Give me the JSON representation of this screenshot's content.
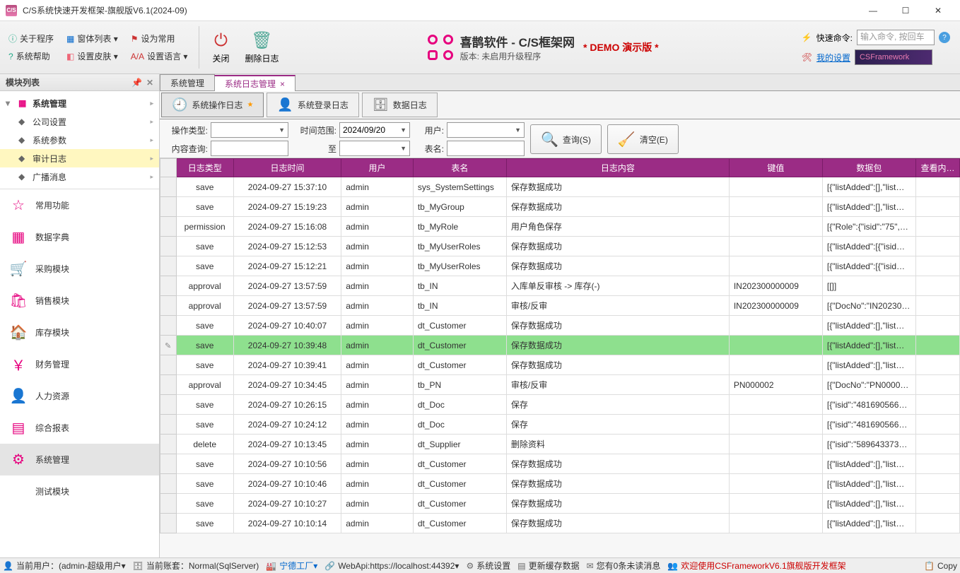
{
  "window": {
    "title": "C/S系统快速开发框架-旗舰版V6.1(2024-09)"
  },
  "ribbon": {
    "about": "关于程序",
    "winlist": "窗体列表 ▾",
    "setcommon": "设为常用",
    "syshelp": "系统帮助",
    "setskin": "设置皮肤 ▾",
    "setlang": "设置语言 ▾",
    "close": "关闭",
    "dellog": "删除日志",
    "brand1": "喜鹊软件 - C/S框架网",
    "brand2": "版本: 未启用升级程序",
    "demo": "* DEMO 演示版 *",
    "quickcmd": "快速命令:",
    "cmdplaceholder": "输入命令, 按回车",
    "mysettings": "我的设置",
    "cfbanner": "CSFramework"
  },
  "sidebar": {
    "header": "模块列表",
    "tree": {
      "root": "系统管理",
      "items": [
        "公司设置",
        "系统参数",
        "审计日志",
        "广播消息"
      ]
    },
    "mods": [
      {
        "icon": "☆",
        "label": "常用功能"
      },
      {
        "icon": "▦",
        "label": "数据字典"
      },
      {
        "icon": "🛒",
        "label": "采购模块"
      },
      {
        "icon": "🛍",
        "label": "销售模块"
      },
      {
        "icon": "🏠",
        "label": "库存模块"
      },
      {
        "icon": "￥",
        "label": "财务管理"
      },
      {
        "icon": "👤",
        "label": "人力资源"
      },
      {
        "icon": "▤",
        "label": "综合报表"
      },
      {
        "icon": "⚙",
        "label": "系统管理"
      },
      {
        "icon": "</>",
        "label": "测试模块"
      }
    ],
    "selmod": 8
  },
  "tabs": {
    "items": [
      {
        "label": "系统管理",
        "closable": false
      },
      {
        "label": "系统日志管理",
        "closable": true
      }
    ],
    "active": 1
  },
  "subtabs": {
    "items": [
      {
        "icon": "🕘",
        "label": "系统操作日志",
        "star": true
      },
      {
        "icon": "👤",
        "label": "系统登录日志"
      },
      {
        "icon": "🗄",
        "label": "数据日志"
      }
    ],
    "active": 0
  },
  "filters": {
    "l_optype": "操作类型:",
    "l_content": "内容查询:",
    "l_range": "时间范围:",
    "l_to": "至",
    "date_from": "2024/09/20",
    "date_to": "",
    "l_user": "用户:",
    "l_table": "表名:",
    "btn_search": "查询(S)",
    "btn_clear": "清空(E)"
  },
  "grid": {
    "cols": [
      "日志类型",
      "日志时间",
      "用户",
      "表名",
      "日志内容",
      "键值",
      "数据包",
      "查看内…"
    ],
    "selrow": 8,
    "rows": [
      [
        "save",
        "2024-09-27 15:37:10",
        "admin",
        "sys_SystemSettings",
        "保存数据成功",
        "",
        "[{\"listAdded\":[],\"list…",
        ""
      ],
      [
        "save",
        "2024-09-27 15:19:23",
        "admin",
        "tb_MyGroup",
        "保存数据成功",
        "",
        "[{\"listAdded\":[],\"list…",
        ""
      ],
      [
        "permission",
        "2024-09-27 15:16:08",
        "admin",
        "tb_MyRole",
        "用户角色保存",
        "",
        "[{\"Role\":{\"isid\":\"75\",…",
        ""
      ],
      [
        "save",
        "2024-09-27 15:12:53",
        "admin",
        "tb_MyUserRoles",
        "保存数据成功",
        "",
        "[{\"listAdded\":[{\"isid…",
        ""
      ],
      [
        "save",
        "2024-09-27 15:12:21",
        "admin",
        "tb_MyUserRoles",
        "保存数据成功",
        "",
        "[{\"listAdded\":[{\"isid…",
        ""
      ],
      [
        "approval",
        "2024-09-27 13:57:59",
        "admin",
        "tb_IN",
        "入库单反审核 -> 库存(-)",
        "IN202300000009",
        "[[]]",
        ""
      ],
      [
        "approval",
        "2024-09-27 13:57:59",
        "admin",
        "tb_IN",
        "审核/反审",
        "IN202300000009",
        "[{\"DocNo\":\"IN20230…",
        ""
      ],
      [
        "save",
        "2024-09-27 10:40:07",
        "admin",
        "dt_Customer",
        "保存数据成功",
        "",
        "[{\"listAdded\":[],\"list…",
        ""
      ],
      [
        "save",
        "2024-09-27 10:39:48",
        "admin",
        "dt_Customer",
        "保存数据成功",
        "",
        "[{\"listAdded\":[],\"list…",
        ""
      ],
      [
        "save",
        "2024-09-27 10:39:41",
        "admin",
        "dt_Customer",
        "保存数据成功",
        "",
        "[{\"listAdded\":[],\"list…",
        ""
      ],
      [
        "approval",
        "2024-09-27 10:34:45",
        "admin",
        "tb_PN",
        "审核/反审",
        "PN000002",
        "[{\"DocNo\":\"PN0000…",
        ""
      ],
      [
        "save",
        "2024-09-27 10:26:15",
        "admin",
        "dt_Doc",
        "保存",
        "",
        "[{\"isid\":\"4816905668…",
        ""
      ],
      [
        "save",
        "2024-09-27 10:24:12",
        "admin",
        "dt_Doc",
        "保存",
        "",
        "[{\"isid\":\"4816905668…",
        ""
      ],
      [
        "delete",
        "2024-09-27 10:13:45",
        "admin",
        "dt_Supplier",
        "删除资料",
        "",
        "[{\"isid\":\"5896433736…",
        ""
      ],
      [
        "save",
        "2024-09-27 10:10:56",
        "admin",
        "dt_Customer",
        "保存数据成功",
        "",
        "[{\"listAdded\":[],\"list…",
        ""
      ],
      [
        "save",
        "2024-09-27 10:10:46",
        "admin",
        "dt_Customer",
        "保存数据成功",
        "",
        "[{\"listAdded\":[],\"list…",
        ""
      ],
      [
        "save",
        "2024-09-27 10:10:27",
        "admin",
        "dt_Customer",
        "保存数据成功",
        "",
        "[{\"listAdded\":[],\"list…",
        ""
      ],
      [
        "save",
        "2024-09-27 10:10:14",
        "admin",
        "dt_Customer",
        "保存数据成功",
        "",
        "[{\"listAdded\":[],\"list…",
        ""
      ]
    ]
  },
  "status": {
    "user": "当前用户：(admin-超级用户▾",
    "account": "当前账套：Normal(SqlServer)",
    "factory": "宁德工厂▾",
    "webapi": "WebApi:https://localhost:44392▾",
    "sysset": "系统设置",
    "updatecache": "更新缓存数据",
    "unread": "您有0条未读消息",
    "welcome": "欢迎使用CSFrameworkV6.1旗舰版开发框架",
    "copy": "Copy"
  }
}
